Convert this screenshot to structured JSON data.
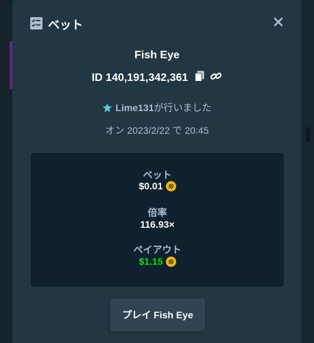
{
  "header": {
    "title": "ベット",
    "icon": "bet-slip-icon",
    "close_icon": "close-icon"
  },
  "bet": {
    "game": "Fish Eye",
    "id": "ID 140,191,342,361",
    "copy_icon": "copy-icon",
    "link_icon": "link-icon",
    "user_icon": "star-rank-icon",
    "username": "Lime131",
    "placed_suffix": "が行いました",
    "datetime": "オン 2023/2/22 で 20:45"
  },
  "stats": {
    "bet_label": "ベット",
    "bet_value": "$0.01",
    "multiplier_label": "倍率",
    "multiplier_value": "116.93×",
    "payout_label": "ペイアウト",
    "payout_value": "$1.15",
    "coin_icon": "usdc-coin-icon"
  },
  "play_button": {
    "label": "プレイ Fish Eye"
  },
  "colors": {
    "modal_bg": "#213743",
    "panel_bg": "#0f212e",
    "muted_text": "#b1bad3",
    "payout_green": "#00e701",
    "coin_gold": "#f5b800",
    "rank_cyan": "#4fd2e0"
  }
}
